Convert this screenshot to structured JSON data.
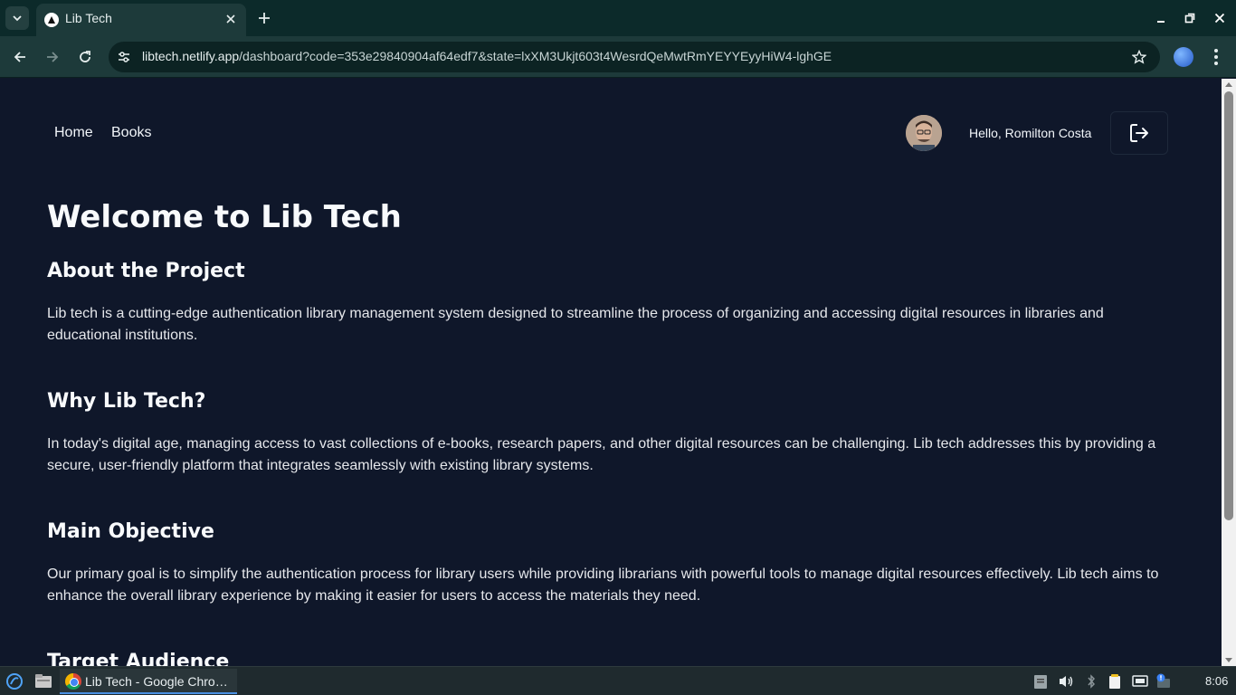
{
  "browser": {
    "tab_title": "Lib Tech",
    "url_host": "libtech.netlify.app",
    "url_path": "/dashboard?code=353e29840904af64edf7&state=lxXM3Ukjt603t4WesrdQeMwtRmYEYYEyyHiW4-lghGE"
  },
  "nav": {
    "home_label": "Home",
    "books_label": "Books",
    "greeting": "Hello, Romilton Costa"
  },
  "page": {
    "title": "Welcome to Lib Tech",
    "sections": [
      {
        "heading": "About the Project",
        "body": "Lib tech is a cutting-edge authentication library management system designed to streamline the process of organizing and accessing digital resources in libraries and educational institutions."
      },
      {
        "heading": "Why Lib Tech?",
        "body": "In today's digital age, managing access to vast collections of e-books, research papers, and other digital resources can be challenging. Lib tech addresses this by providing a secure, user-friendly platform that integrates seamlessly with existing library systems."
      },
      {
        "heading": "Main Objective",
        "body": "Our primary goal is to simplify the authentication process for library users while providing librarians with powerful tools to manage digital resources effectively. Lib tech aims to enhance the overall library experience by making it easier for users to access the materials they need."
      },
      {
        "heading": "Target Audience"
      }
    ]
  },
  "taskbar": {
    "task_label": "Lib Tech - Google Chro…",
    "clock": "8:06"
  },
  "colors": {
    "page_bg": "#0f172a",
    "text": "#f8fafc",
    "chrome_bg": "#1d3a3a"
  }
}
